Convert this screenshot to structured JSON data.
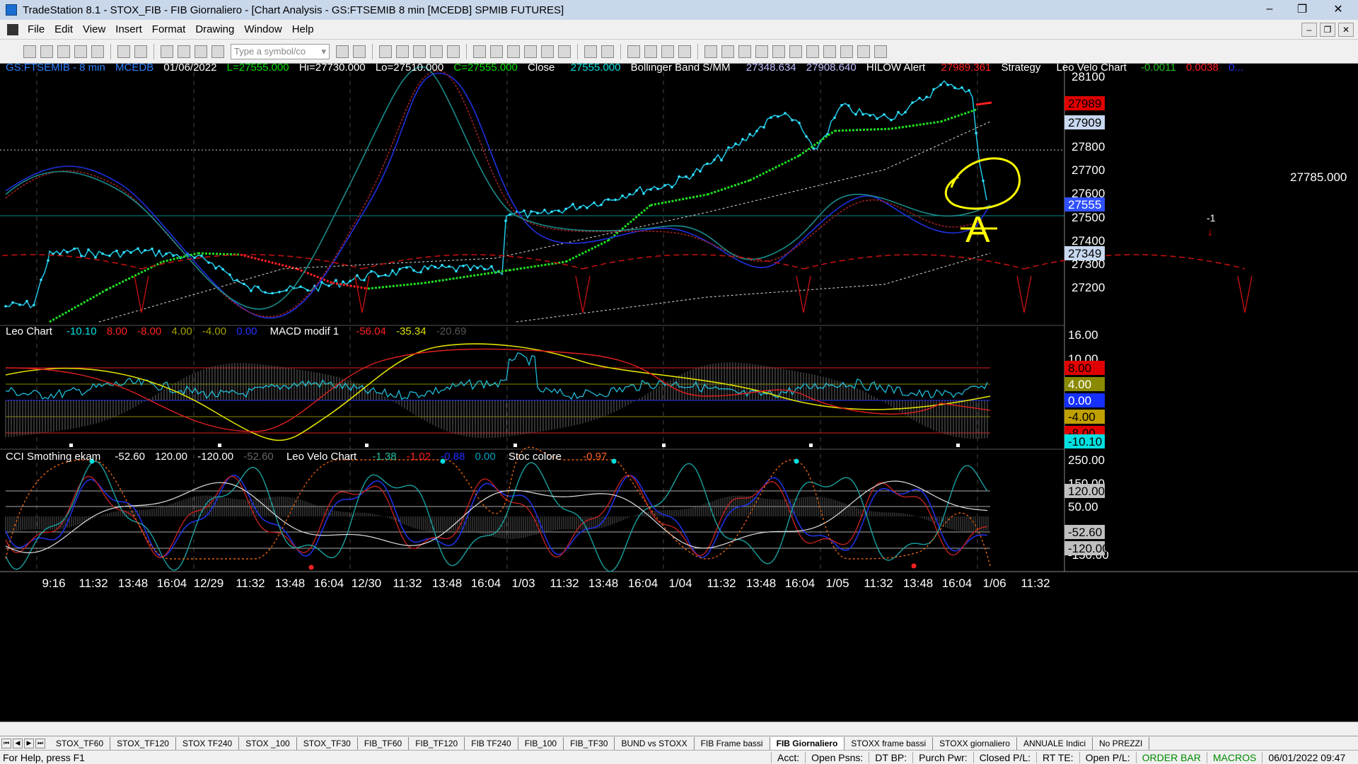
{
  "window": {
    "title": "TradeStation 8.1 - STOX_FIB - FIB Giornaliero - [Chart Analysis - GS:FTSEMIB  8 min  [MCEDB] SPMIB FUTURES]",
    "minimize": "–",
    "maximize": "❐",
    "close": "✕"
  },
  "menu": {
    "items": [
      "File",
      "Edit",
      "View",
      "Insert",
      "Format",
      "Drawing",
      "Window",
      "Help"
    ],
    "mdi": [
      "–",
      "❐",
      "✕"
    ]
  },
  "toolbar": {
    "symbol_placeholder": "Type a symbol/co"
  },
  "chart": {
    "header1": {
      "symbol": "GS:FTSEMIB - 8 min",
      "datasource": "MCEDB",
      "date": "01/06/2022",
      "low_open": "L=27555.000",
      "hi": "Hi=27730.000",
      "lo": "Lo=27510.000",
      "close": "C=27555.000",
      "close_label": "Close",
      "close_val": "27555.000",
      "bb_label": "Bollinger Band S/MM",
      "bb1": "27348.634",
      "bb2": "27908.640",
      "hilow": "HILOW Alert",
      "hilow_val": "27989.361",
      "strategy": "Strategy",
      "leo": "Leo Velo Chart",
      "leo1": "-0.0011",
      "leo2": "0.0038",
      "leo3": "0..."
    },
    "header2": {
      "leo": "Leo Chart",
      "v1": "-10.10",
      "v2": "8.00",
      "v3": "-8.00",
      "v4": "4.00",
      "v5": "-4.00",
      "v6": "0.00",
      "macd": "MACD modif 1",
      "m1": "-56.04",
      "m2": "-35.34",
      "m3": "-20.69"
    },
    "header3": {
      "cci": "CCI Smothing ekam",
      "c1": "-52.60",
      "c2": "120.00",
      "c3": "-120.00",
      "c4": "-52.60",
      "leo": "Leo Velo Chart",
      "l1": "-1.38",
      "l2": "-1.02",
      "l3": "-0.88",
      "l4": "0.00",
      "stoc": "Stoc colore",
      "s1": "-0.97"
    },
    "price_axis": [
      "28100",
      "27900",
      "27800",
      "27700",
      "27600",
      "27500",
      "27400",
      "27300",
      "27200"
    ],
    "price_badges": [
      {
        "text": "27989",
        "bg": "#e00000",
        "fg": "#000000"
      },
      {
        "text": "27909",
        "bg": "#c8d8f0",
        "fg": "#000000"
      },
      {
        "text": "27555",
        "bg": "#3050ff",
        "fg": "#ffffff"
      },
      {
        "text": "27349",
        "bg": "#c8d8f0",
        "fg": "#000000"
      }
    ],
    "crosshair_label": "27785.000",
    "annotation_letter": "A",
    "arrow_label": "-1",
    "osc_axis": [
      "16.00",
      "10.00"
    ],
    "osc_badges": [
      {
        "text": "8.00",
        "bg": "#e00000",
        "fg": "#000000"
      },
      {
        "text": "4.00",
        "bg": "#8a8a00",
        "fg": "#ffffff"
      },
      {
        "text": "0.00",
        "bg": "#1530ff",
        "fg": "#ffffff"
      },
      {
        "text": "-4.00",
        "bg": "#c0a000",
        "fg": "#000000"
      },
      {
        "text": "-8.00",
        "bg": "#e00000",
        "fg": "#000000"
      },
      {
        "text": "-10.10",
        "bg": "#00e0e0",
        "fg": "#000000"
      }
    ],
    "cci_axis": [
      "250.00",
      "150.00",
      "50.00",
      "-150.00"
    ],
    "cci_badges": [
      {
        "text": "120.00",
        "bg": "#c0c0c0",
        "fg": "#000000"
      },
      {
        "text": "-52.60",
        "bg": "#c0c0c0",
        "fg": "#000000"
      },
      {
        "text": "-120.00",
        "bg": "#c0c0c0",
        "fg": "#000000"
      }
    ],
    "time_axis": [
      "9:16",
      "11:32",
      "13:48",
      "16:04",
      "12/29",
      "11:32",
      "13:48",
      "16:04",
      "12/30",
      "11:32",
      "13:48",
      "16:04",
      "1/03",
      "11:32",
      "13:48",
      "16:04",
      "1/04",
      "11:32",
      "13:48",
      "16:04",
      "1/05",
      "11:32",
      "13:48",
      "16:04",
      "1/06",
      "11:32"
    ]
  },
  "tabs": [
    "STOX_TF60",
    "STOX_TF120",
    "STOX TF240",
    "STOX _100",
    "STOX_TF30",
    "FIB_TF60",
    "FIB_TF120",
    "FIB TF240",
    "FIB_100",
    "FIB_TF30",
    "BUND vs STOXX",
    "FIB Frame bassi",
    "FIB Giornaliero",
    "STOXX frame bassi",
    "STOXX giornaliero",
    "ANNUALE Indici",
    "No PREZZI"
  ],
  "active_tab": "FIB Giornaliero",
  "status": {
    "help": "For Help, press F1",
    "acct": "Acct:",
    "open_psns": "Open Psns:",
    "dt_bp": "DT BP:",
    "purch_pwr": "Purch Pwr:",
    "closed_pl": "Closed P/L:",
    "rt_te": "RT TE:",
    "open_pl": "Open P/L:",
    "order_bar": "ORDER BAR",
    "macros": "MACROS",
    "datetime": "06/01/2022 09:47"
  }
}
